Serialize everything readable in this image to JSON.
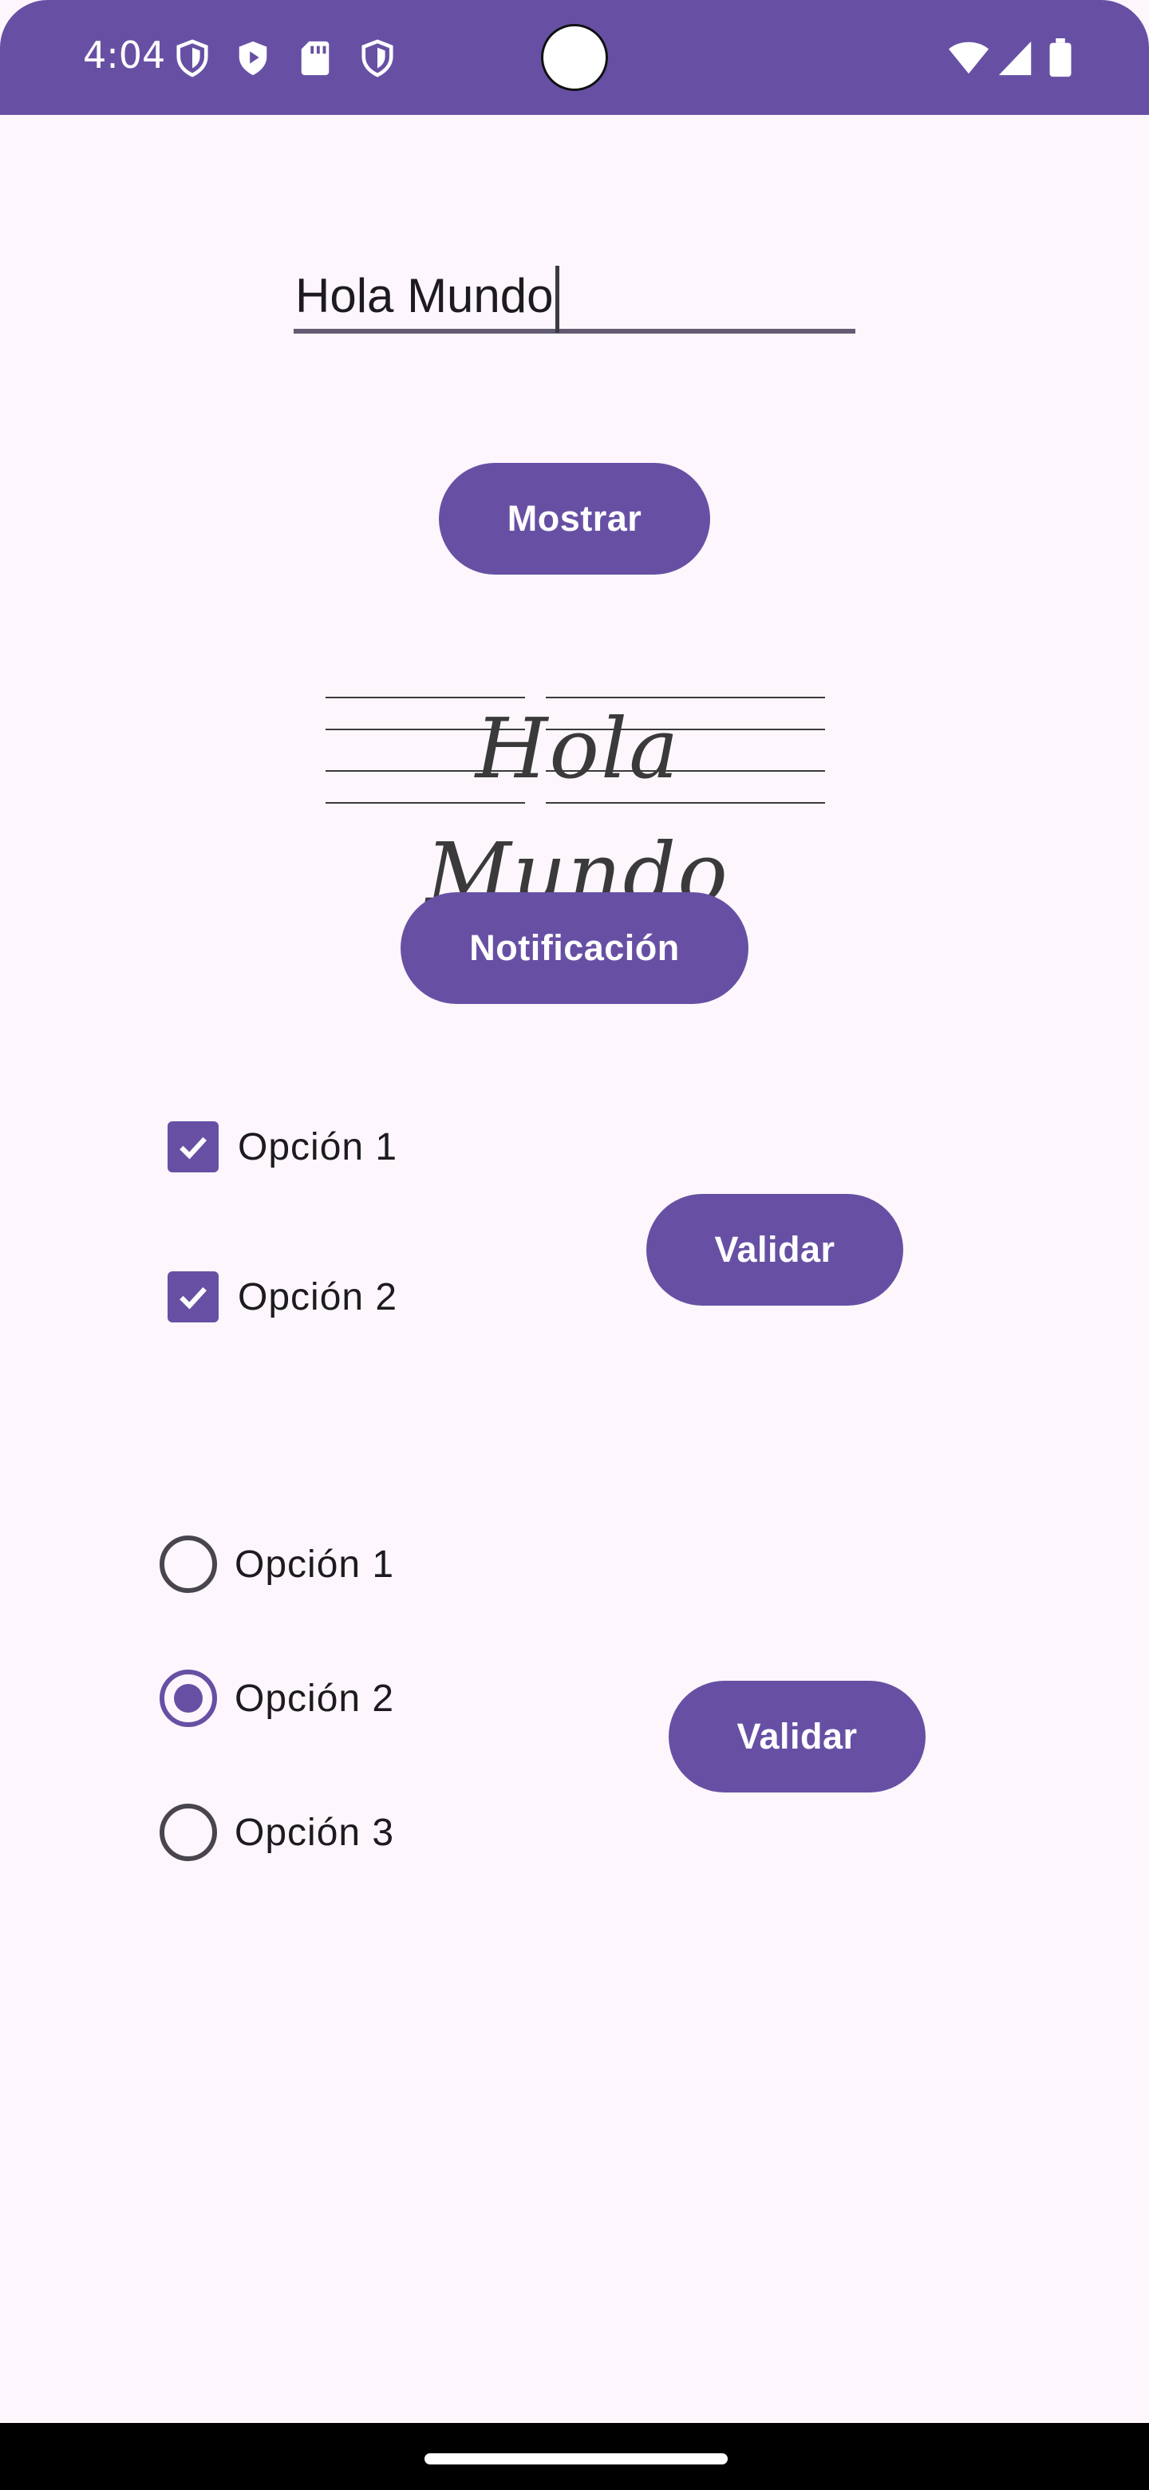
{
  "status_bar": {
    "time": "4:04",
    "left_icons": [
      "shield-icon",
      "play-protect-icon",
      "sd-card-icon",
      "shield-icon"
    ],
    "right_icons": [
      "wifi-icon",
      "signal-icon",
      "battery-icon"
    ],
    "background_color": "#6750A4"
  },
  "text_field": {
    "value": "Hola Mundo"
  },
  "buttons": {
    "show_label": "Mostrar",
    "notification_label": "Notificación",
    "validate_checks_label": "Validar",
    "validate_radios_label": "Validar"
  },
  "cursive_label": {
    "text": "Hola Mundo"
  },
  "checkboxes": [
    {
      "label": "Opción 1",
      "checked": true
    },
    {
      "label": "Opción 2",
      "checked": true
    }
  ],
  "radios": [
    {
      "label": "Opción 1",
      "checked": false
    },
    {
      "label": "Opción 2",
      "checked": true
    },
    {
      "label": "Opción 3",
      "checked": false
    }
  ],
  "colors": {
    "primary": "#6750A4",
    "background": "#FDF7FD",
    "on_surface": "#1D1B20"
  }
}
